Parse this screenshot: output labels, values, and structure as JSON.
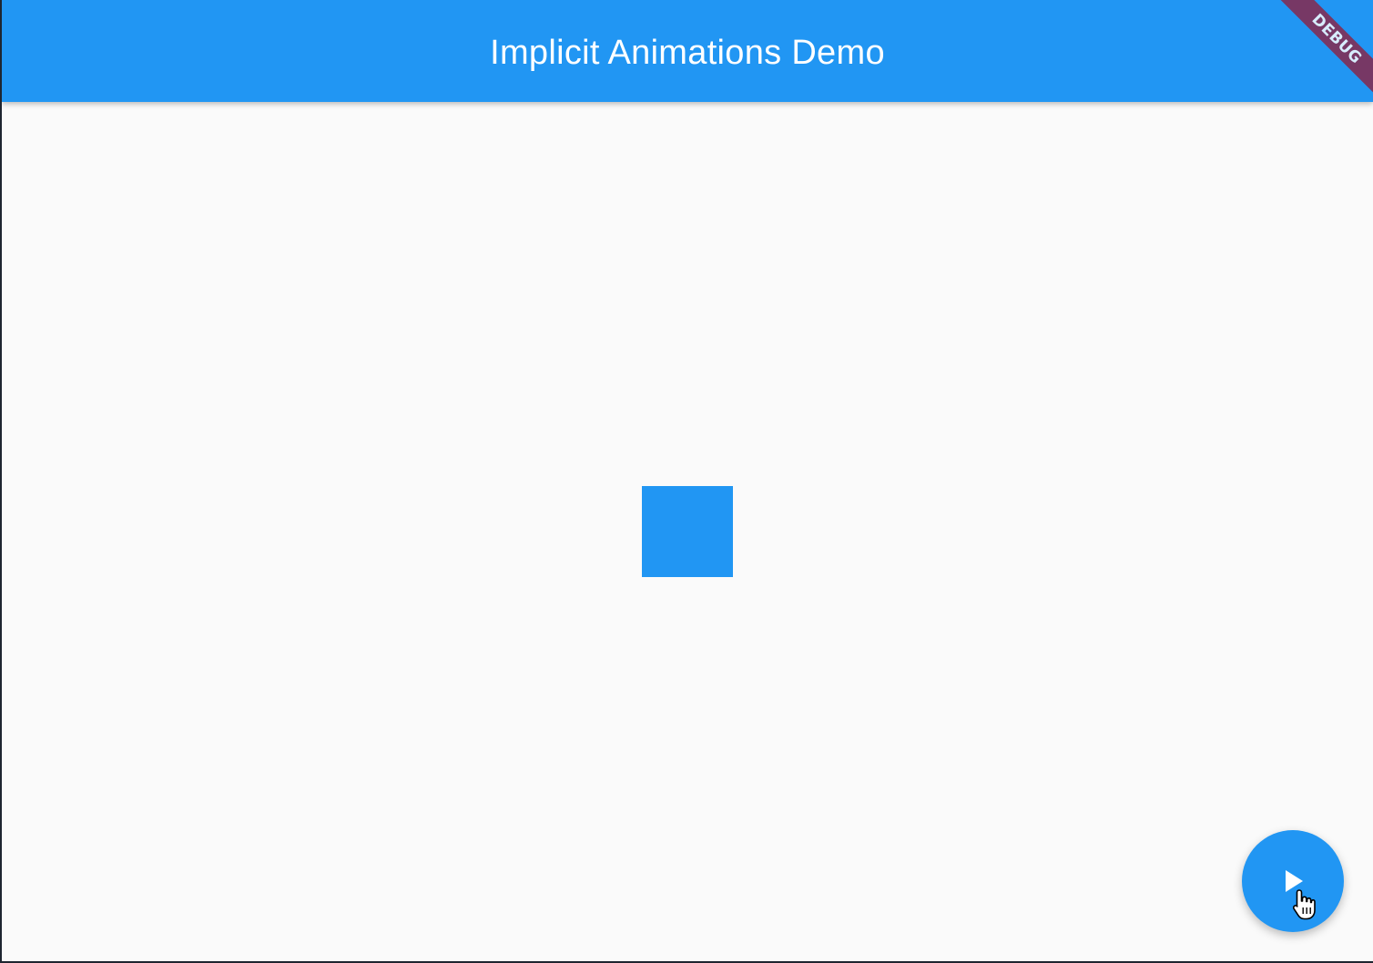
{
  "app_bar": {
    "title": "Implicit Animations Demo",
    "color": "#2196f3"
  },
  "debug_banner": {
    "label": "DEBUG",
    "color": "#8a2446"
  },
  "animated_box": {
    "color": "#2196f3"
  },
  "fab": {
    "icon": "play-icon",
    "color": "#2196f3"
  },
  "cursor": {
    "icon": "hand-pointer-icon"
  },
  "background": "#fafafa"
}
